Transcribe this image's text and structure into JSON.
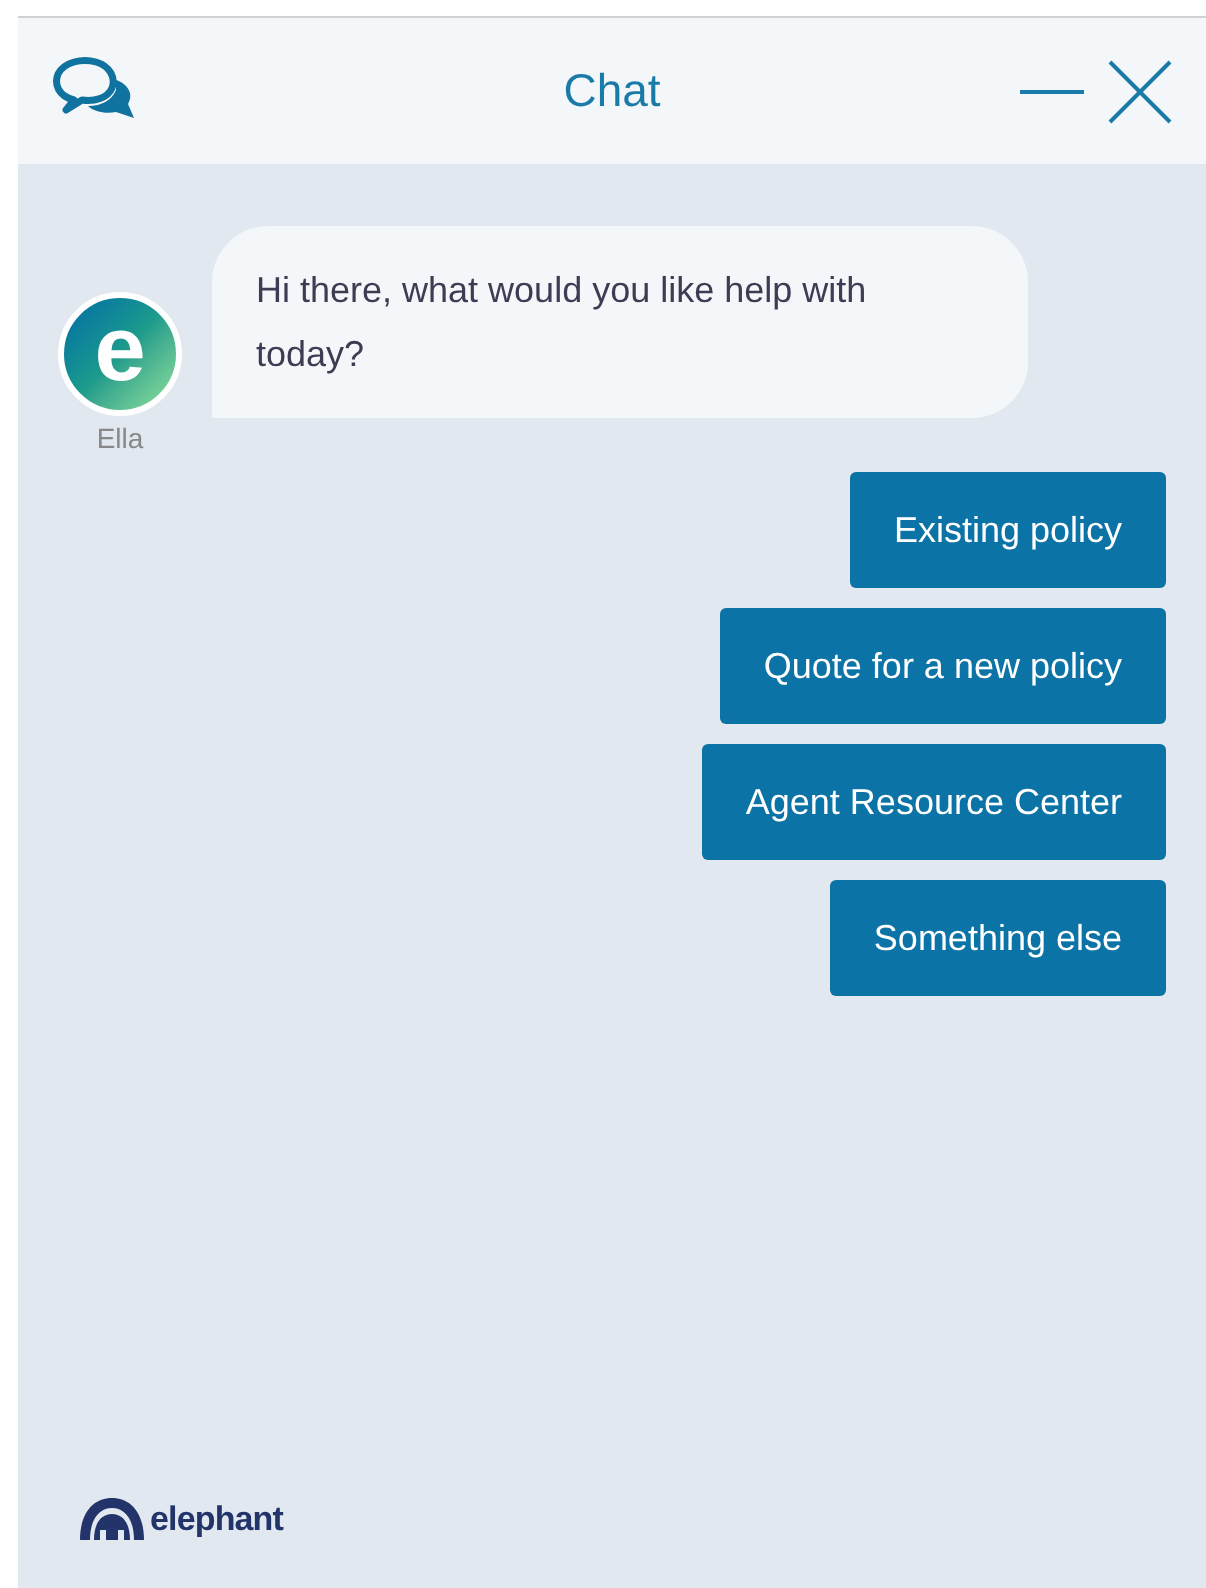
{
  "header": {
    "title": "Chat"
  },
  "message": {
    "sender": "Ella",
    "avatar_letter": "e",
    "text": "Hi there, what would you like help with today?"
  },
  "options": [
    "Existing policy",
    "Quote for a new policy",
    "Agent Resource Center",
    "Something else"
  ],
  "footer": {
    "brand": "elephant"
  }
}
